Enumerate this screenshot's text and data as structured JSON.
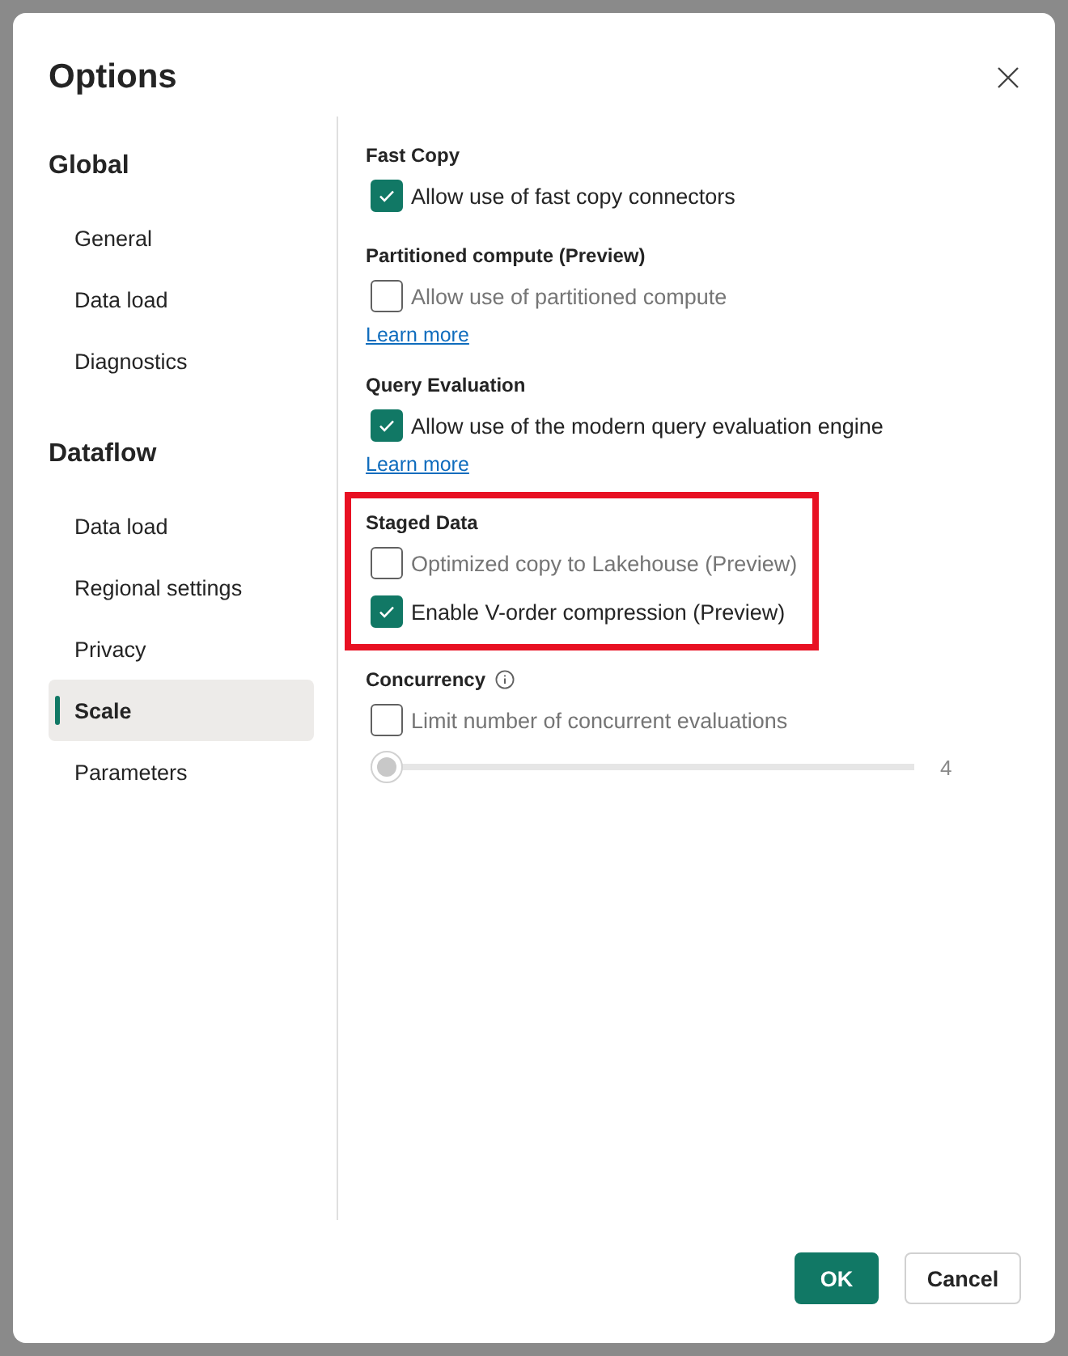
{
  "dialog": {
    "title": "Options"
  },
  "sidebar": {
    "groups": [
      {
        "heading": "Global",
        "items": [
          {
            "label": "General",
            "selected": false
          },
          {
            "label": "Data load",
            "selected": false
          },
          {
            "label": "Diagnostics",
            "selected": false
          }
        ]
      },
      {
        "heading": "Dataflow",
        "items": [
          {
            "label": "Data load",
            "selected": false
          },
          {
            "label": "Regional settings",
            "selected": false
          },
          {
            "label": "Privacy",
            "selected": false
          },
          {
            "label": "Scale",
            "selected": true
          },
          {
            "label": "Parameters",
            "selected": false
          }
        ]
      }
    ]
  },
  "sections": [
    {
      "heading": "Fast Copy",
      "info": false,
      "highlighted": false,
      "options": [
        {
          "label": "Allow use of fast copy connectors",
          "checked": true,
          "disabled": false
        }
      ]
    },
    {
      "heading": "Partitioned compute (Preview)",
      "info": false,
      "highlighted": false,
      "options": [
        {
          "label": "Allow use of partitioned compute",
          "checked": false,
          "disabled": true
        }
      ],
      "link": "Learn more"
    },
    {
      "heading": "Query Evaluation",
      "info": false,
      "highlighted": false,
      "options": [
        {
          "label": "Allow use of the modern query evaluation engine",
          "checked": true,
          "disabled": false
        }
      ],
      "link": "Learn more"
    },
    {
      "heading": "Staged Data",
      "info": false,
      "highlighted": true,
      "options": [
        {
          "label": "Optimized copy to Lakehouse (Preview)",
          "checked": false,
          "disabled": true
        },
        {
          "label": "Enable V-order compression (Preview)",
          "checked": true,
          "disabled": false
        }
      ]
    },
    {
      "heading": "Concurrency",
      "info": true,
      "highlighted": false,
      "options": [
        {
          "label": "Limit number of concurrent evaluations",
          "checked": false,
          "disabled": true
        }
      ],
      "slider": {
        "level": 0,
        "reading": "4",
        "disabled": true
      }
    }
  ],
  "buttons": [
    {
      "label": "OK",
      "kind": "primary"
    },
    {
      "label": "Cancel",
      "kind": "secondary"
    }
  ]
}
